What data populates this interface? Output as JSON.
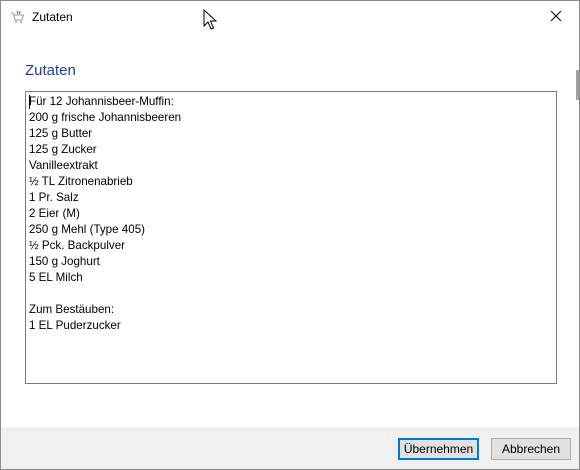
{
  "window": {
    "title": "Zutaten",
    "icon": "basket-icon",
    "close_icon": "close-icon"
  },
  "dialog": {
    "heading": "Zutaten",
    "lines": [
      "Für 12 Johannisbeer-Muffin:",
      "200 g frische Johannisbeeren",
      "125 g Butter",
      "125 g Zucker",
      "Vanilleextrakt",
      "½ TL Zitronenabrieb",
      "1 Pr. Salz",
      "2 Eier (M)",
      "250 g Mehl (Type 405)",
      "½ Pck. Backpulver",
      "150 g Joghurt",
      "5 EL Milch",
      "",
      "Zum Bestäuben:",
      "1 EL Puderzucker"
    ]
  },
  "buttons": {
    "ok": "Übernehmen",
    "cancel": "Abbrechen"
  },
  "colors": {
    "heading": "#1f3f95",
    "default_button_border": "#0078d7",
    "footer_bg": "#f0f0f0"
  }
}
